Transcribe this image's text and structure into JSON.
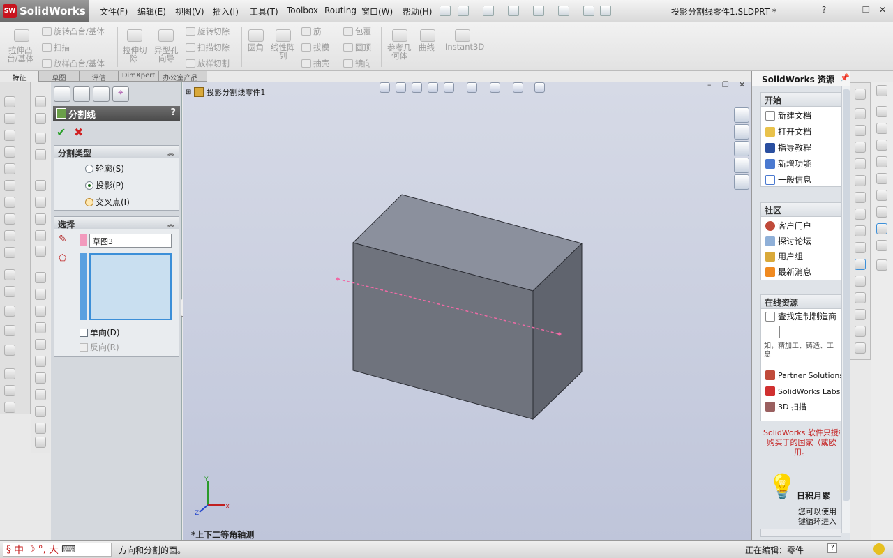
{
  "app": {
    "name": "SolidWorks",
    "logo_text": "SW",
    "document_title": "投影分割线零件1.SLDPRT *"
  },
  "menubar": {
    "items": [
      "文件(F)",
      "编辑(E)",
      "视图(V)",
      "插入(I)",
      "工具(T)",
      "Toolbox",
      "Routing",
      "窗口(W)",
      "帮助(H)"
    ],
    "help_symbol": "?"
  },
  "ribbon": {
    "col1": [
      "拉伸凸",
      "台/基体"
    ],
    "col2": [
      "旋转凸台/基体",
      "扫描",
      "放样凸台/基体"
    ],
    "col3": [
      "拉伸切",
      "除"
    ],
    "col4": [
      "异型孔",
      "向导"
    ],
    "col5": [
      "旋转切除",
      "扫描切除",
      "放样切割"
    ],
    "col6": [
      "圆角"
    ],
    "col7": [
      "线性阵",
      "列"
    ],
    "col8": [
      "筋",
      "拔模",
      "抽壳"
    ],
    "col9": [
      "包覆",
      "圆顶",
      "镜向"
    ],
    "col10": [
      "参考几",
      "何体"
    ],
    "col11": [
      "曲线"
    ],
    "col12": [
      "Instant3D"
    ]
  },
  "tabs": [
    "特征",
    "草图",
    "评估",
    "DimXpert",
    "办公室产品"
  ],
  "propertymanager": {
    "title": "分割线",
    "help": "?",
    "ok": "✔",
    "cancel": "✖",
    "group_type": {
      "title": "分割类型",
      "options": [
        "轮廓(S)",
        "投影(P)",
        "交叉点(I)"
      ],
      "selected": "投影(P)"
    },
    "group_select": {
      "title": "选择",
      "sketch_value": "草图3",
      "single_dir": "单向(D)",
      "reverse": "反向(R)"
    }
  },
  "viewport": {
    "tree_root": "投影分割线零件1",
    "view_name": "*上下二等角轴测",
    "axes": {
      "x": "X",
      "y": "Y",
      "z": "Z"
    }
  },
  "taskpane": {
    "title": "SolidWorks 资源",
    "start": {
      "title": "开始",
      "items": [
        "新建文档",
        "打开文档",
        "指导教程",
        "新增功能",
        "一般信息"
      ]
    },
    "community": {
      "title": "社区",
      "items": [
        "客户门户",
        "探讨论坛",
        "用户组",
        "最新消息"
      ]
    },
    "online": {
      "title": "在线资源",
      "find": "查找定制制造商",
      "hint": "如，精加工、铸造、工",
      "hint2": "息",
      "items": [
        "Partner Solutions(I",
        "SolidWorks Labs",
        "3D 扫描"
      ]
    },
    "license": [
      "SolidWorks 软件只授权",
      "购买于的国家（或欧",
      "用。"
    ],
    "tip": {
      "title": "日积月累",
      "lines": [
        "您可以使用",
        "键循环进入"
      ]
    }
  },
  "status": {
    "text": "方向和分割的面。",
    "editing": "正在编辑：零件",
    "ime": [
      "中",
      "大"
    ],
    "help": "?"
  },
  "colors": {
    "accent": "#3c8fd8",
    "sketch_line": "#f06aa6",
    "box_top": "#8b909d",
    "box_front": "#6f737d",
    "box_side": "#60646e",
    "license_text": "#c41e1e"
  }
}
